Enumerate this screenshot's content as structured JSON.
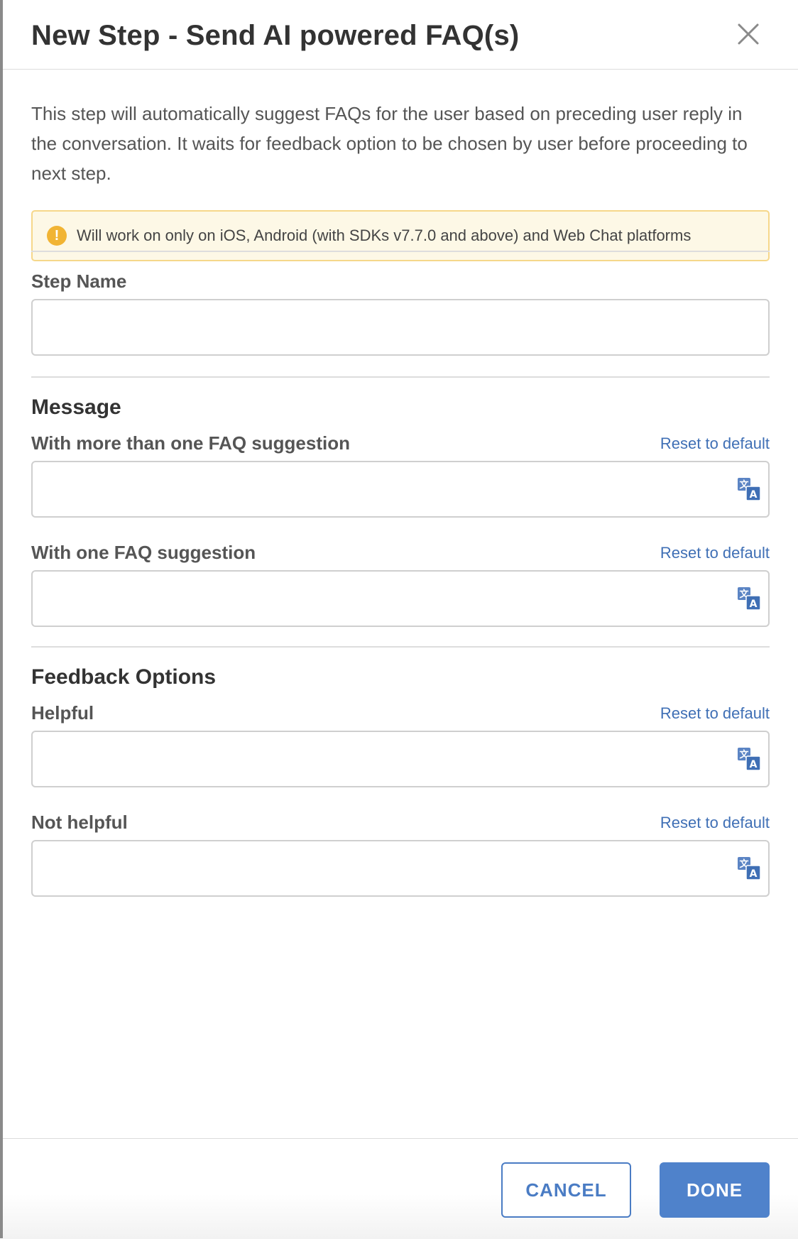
{
  "modal": {
    "title": "New Step - Send AI powered FAQ(s)",
    "description": "This step will automatically suggest FAQs for the user based on preceding user reply in the conversation. It waits for feedback option to be chosen by user before proceeding to next step.",
    "warning": {
      "icon": "!",
      "text": "Will work on only on iOS, Android (with SDKs v7.7.0 and above) and Web Chat platforms"
    }
  },
  "step_name": {
    "label": "Step Name",
    "value": ""
  },
  "message_section": {
    "title": "Message",
    "multi_faq": {
      "label": "With more than one FAQ suggestion",
      "reset_label": "Reset to default",
      "value": ""
    },
    "single_faq": {
      "label": "With one FAQ suggestion",
      "reset_label": "Reset to default",
      "value": ""
    }
  },
  "feedback_section": {
    "title": "Feedback Options",
    "helpful": {
      "label": "Helpful",
      "reset_label": "Reset to default",
      "value": ""
    },
    "not_helpful": {
      "label": "Not helpful",
      "reset_label": "Reset to default",
      "value": ""
    }
  },
  "footer": {
    "cancel_label": "CANCEL",
    "done_label": "DONE"
  },
  "colors": {
    "accent": "#4f82cb",
    "link": "#3f6fb5",
    "warning_bg": "#fdf8e6",
    "warning_border": "#f6d78a",
    "warning_icon": "#f1b434"
  },
  "icons": {
    "close": "close-icon",
    "warning": "warning-icon",
    "translate": "translate-icon"
  }
}
